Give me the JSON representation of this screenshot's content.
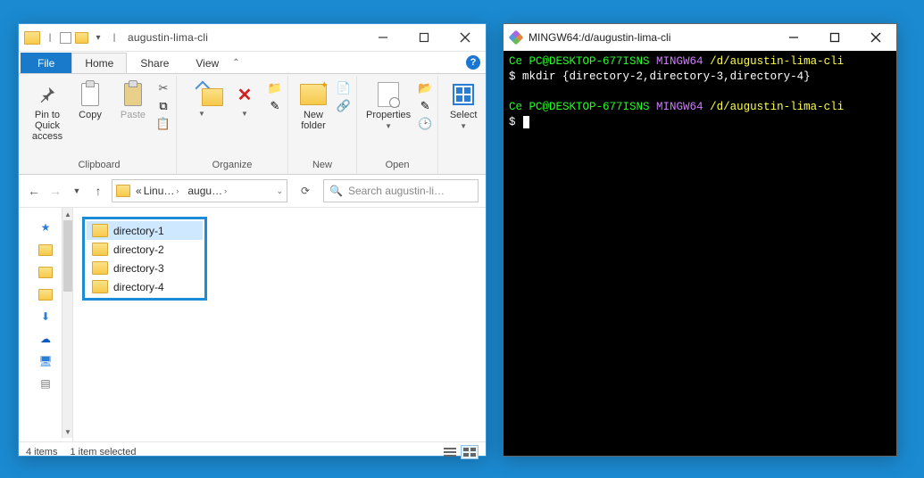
{
  "explorer": {
    "title": "augustin-lima-cli",
    "tabs": {
      "file": "File",
      "home": "Home",
      "share": "Share",
      "view": "View",
      "active": "Home"
    },
    "ribbon": {
      "clipboard": {
        "label": "Clipboard",
        "pin": "Pin to Quick access",
        "copy": "Copy",
        "paste": "Paste"
      },
      "organize": {
        "label": "Organize"
      },
      "new": {
        "label": "New",
        "newfolder": "New folder"
      },
      "open": {
        "label": "Open",
        "properties": "Properties"
      },
      "select": {
        "label": "Select"
      }
    },
    "address": {
      "crumb1": "Linu…",
      "crumb2": "augu…",
      "search_placeholder": "Search augustin-li…"
    },
    "folders": [
      {
        "name": "directory-1",
        "selected": true
      },
      {
        "name": "directory-2",
        "selected": false
      },
      {
        "name": "directory-3",
        "selected": false
      },
      {
        "name": "directory-4",
        "selected": false
      }
    ],
    "status": {
      "count": "4 items",
      "selection": "1 item selected"
    }
  },
  "terminal": {
    "title": "MINGW64:/d/augustin-lima-cli",
    "prompt": {
      "user": "Ce PC@DESKTOP-677ISNS",
      "env": "MINGW64",
      "path": "/d/augustin-lima-cli"
    },
    "command": "mkdir {directory-2,directory-3,directory-4}",
    "prompt_char": "$"
  }
}
